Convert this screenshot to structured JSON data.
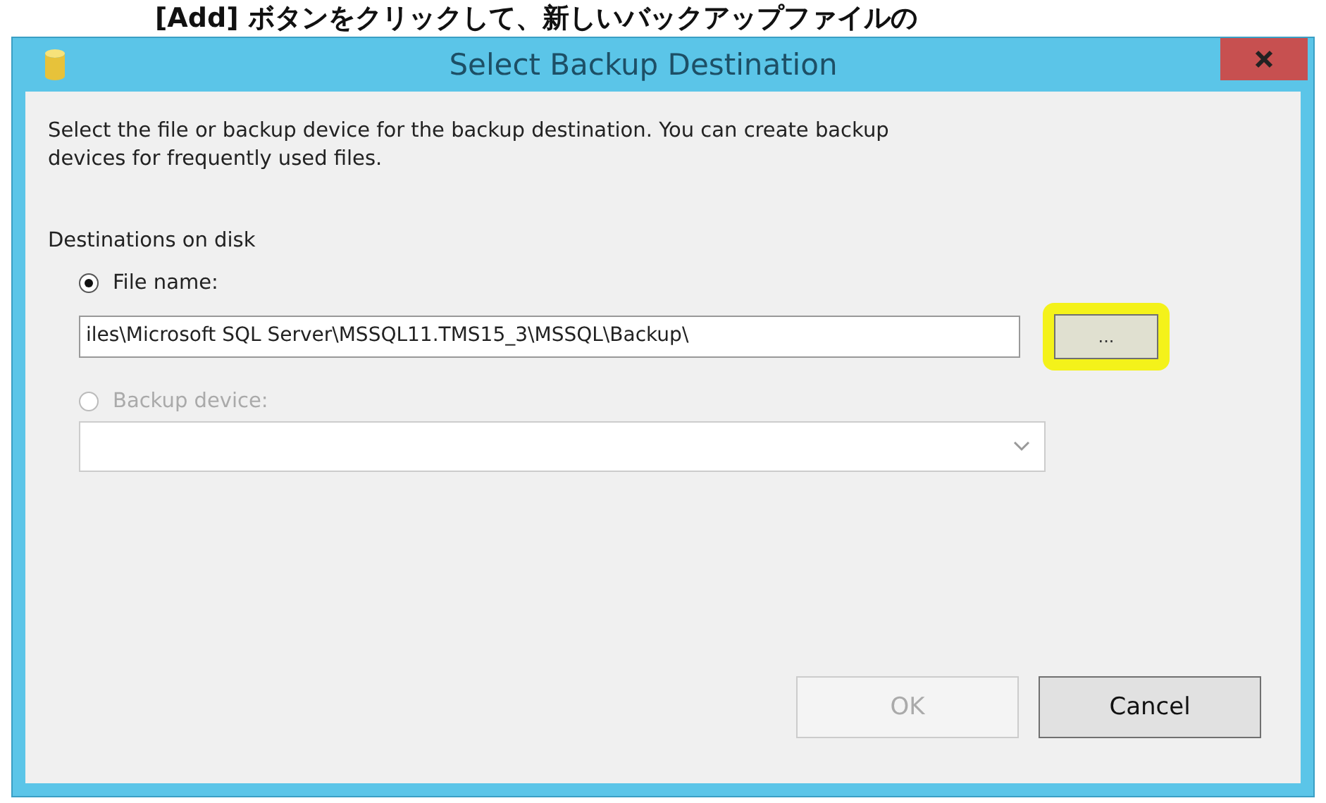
{
  "caption": "[Add] ボタンをクリックして、新しいバックアップファイルの",
  "window": {
    "title": "Select Backup Destination"
  },
  "description": "Select the file or backup device for the backup destination. You can create backup devices for frequently used files.",
  "group_label": "Destinations on disk",
  "options": [
    {
      "kind": "file",
      "label": "File name:",
      "selected": true,
      "disabled": false,
      "value": "iles\\Microsoft SQL Server\\MSSQL11.TMS15_3\\MSSQL\\Backup\\",
      "browse_label": "...",
      "highlighted": true
    },
    {
      "kind": "device",
      "label": "Backup device:",
      "selected": false,
      "disabled": true
    }
  ],
  "buttons": [
    {
      "label": "OK",
      "disabled": true
    },
    {
      "label": "Cancel",
      "disabled": false
    }
  ]
}
